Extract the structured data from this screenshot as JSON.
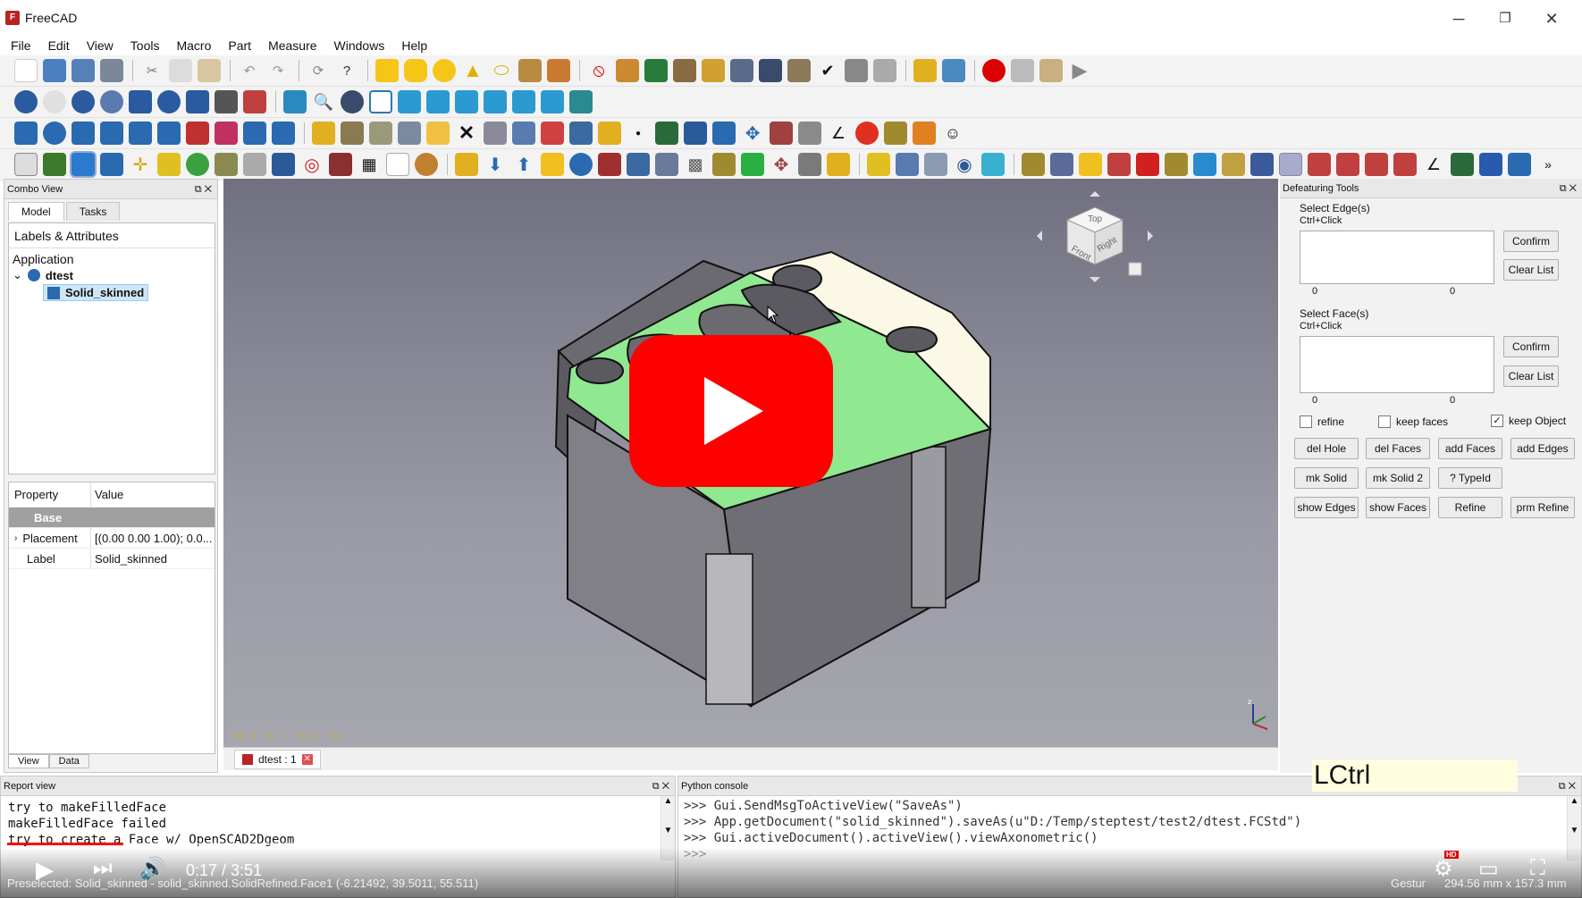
{
  "window": {
    "title": "FreeCAD",
    "minimize": "─",
    "maximize": "❐",
    "close": "✕"
  },
  "menu": [
    "File",
    "Edit",
    "View",
    "Tools",
    "Macro",
    "Part",
    "Measure",
    "Windows",
    "Help"
  ],
  "combo": {
    "title": "Combo View",
    "tabs": [
      "Model",
      "Tasks"
    ],
    "tree_header": "Labels & Attributes",
    "application": "Application",
    "doc": "dtest",
    "object": "Solid_skinned",
    "bottom_tabs": [
      "View",
      "Data"
    ]
  },
  "properties": {
    "col_property": "Property",
    "col_value": "Value",
    "group": "Base",
    "rows": [
      {
        "name": "Placement",
        "value": "[(0.00 0.00 1.00); 0.0..."
      },
      {
        "name": "Label",
        "value": "Solid_skinned"
      }
    ]
  },
  "viewport": {
    "fps": "60.5 ms / 16.5 fps",
    "nav_cube": {
      "top": "Top",
      "front": "Front",
      "right": "Right"
    }
  },
  "doc_tab": {
    "label": "dtest : 1"
  },
  "defeaturing": {
    "title": "Defeaturing Tools",
    "edges_label": "Select Edge(s)",
    "edges_hint": "Ctrl+Click",
    "faces_label": "Select Face(s)",
    "faces_hint": "Ctrl+Click",
    "confirm": "Confirm",
    "clear": "Clear List",
    "count_a": "0",
    "count_b": "0",
    "refine": "refine",
    "keep_faces": "keep faces",
    "keep_object": "keep Object",
    "buttons": [
      "del Hole",
      "del Faces",
      "add Faces",
      "add Edges",
      "mk Solid",
      "mk Solid 2",
      "? TypeId",
      "show Edges",
      "show Faces",
      "Refine",
      "prm Refine"
    ]
  },
  "report": {
    "title": "Report view",
    "lines": [
      "try to makeFilledFace",
      "makeFilledFace failed",
      "try to create a Face w/ OpenSCAD2Dgeom"
    ]
  },
  "python": {
    "title": "Python console",
    "lines": [
      ">>> Gui.SendMsgToActiveView(\"SaveAs\")",
      ">>> App.getDocument(\"solid_skinned\").saveAs(u\"D:/Temp/steptest/test2/dtest.FCStd\")",
      ">>> Gui.activeDocument().activeView().viewAxonometric()",
      ">>>"
    ]
  },
  "overlay_key": "LCtrl",
  "video": {
    "time": "0:17 / 3:51",
    "progress": 0.074
  },
  "status": {
    "preselected": "Preselected: Solid_skinned - solid_skinned.SolidRefined.Face1 (-6.21492, 39.5011, 55.511)",
    "nav_style": "Gestur",
    "dimensions": "294.56 mm x 157.3 mm"
  },
  "colors": {
    "accent_green": "#90e890",
    "top_face": "#fbf8e6",
    "youtube_red": "#ff0000"
  }
}
